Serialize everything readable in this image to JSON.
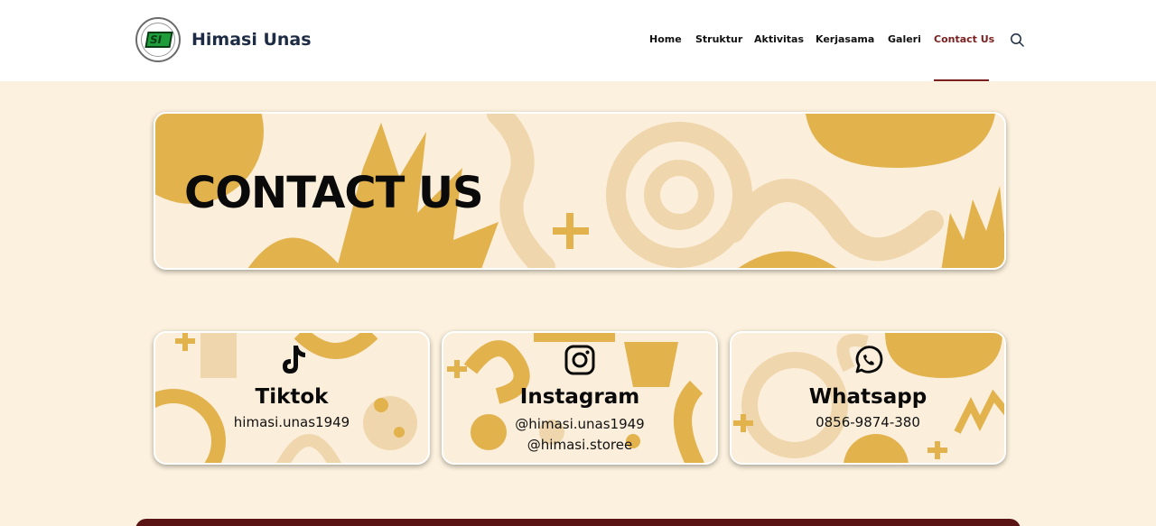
{
  "header": {
    "brand_name": "Himasi Unas",
    "logo_text": "SI",
    "nav": [
      {
        "label": "Home",
        "active": false
      },
      {
        "label": "Struktur",
        "active": false
      },
      {
        "label": "Aktivitas",
        "active": false
      },
      {
        "label": "Kerjasama",
        "active": false
      },
      {
        "label": "Galeri",
        "active": false
      },
      {
        "label": "Contact Us",
        "active": true
      }
    ],
    "search_icon": "search-icon"
  },
  "hero": {
    "title": "CONTACT US"
  },
  "cards": [
    {
      "icon": "tiktok-icon",
      "title": "Tiktok",
      "lines": [
        "himasi.unas1949"
      ]
    },
    {
      "icon": "instagram-icon",
      "title": "Instagram",
      "lines": [
        "@himasi.unas1949",
        "@himasi.storee"
      ]
    },
    {
      "icon": "whatsapp-icon",
      "title": "Whatsapp",
      "lines": [
        "0856-9874-380"
      ]
    }
  ],
  "colors": {
    "page_bg": "#fcf1de",
    "accent": "#7a1f1f",
    "pattern_gold": "#e2b24d",
    "pattern_light": "#efd6ac"
  }
}
